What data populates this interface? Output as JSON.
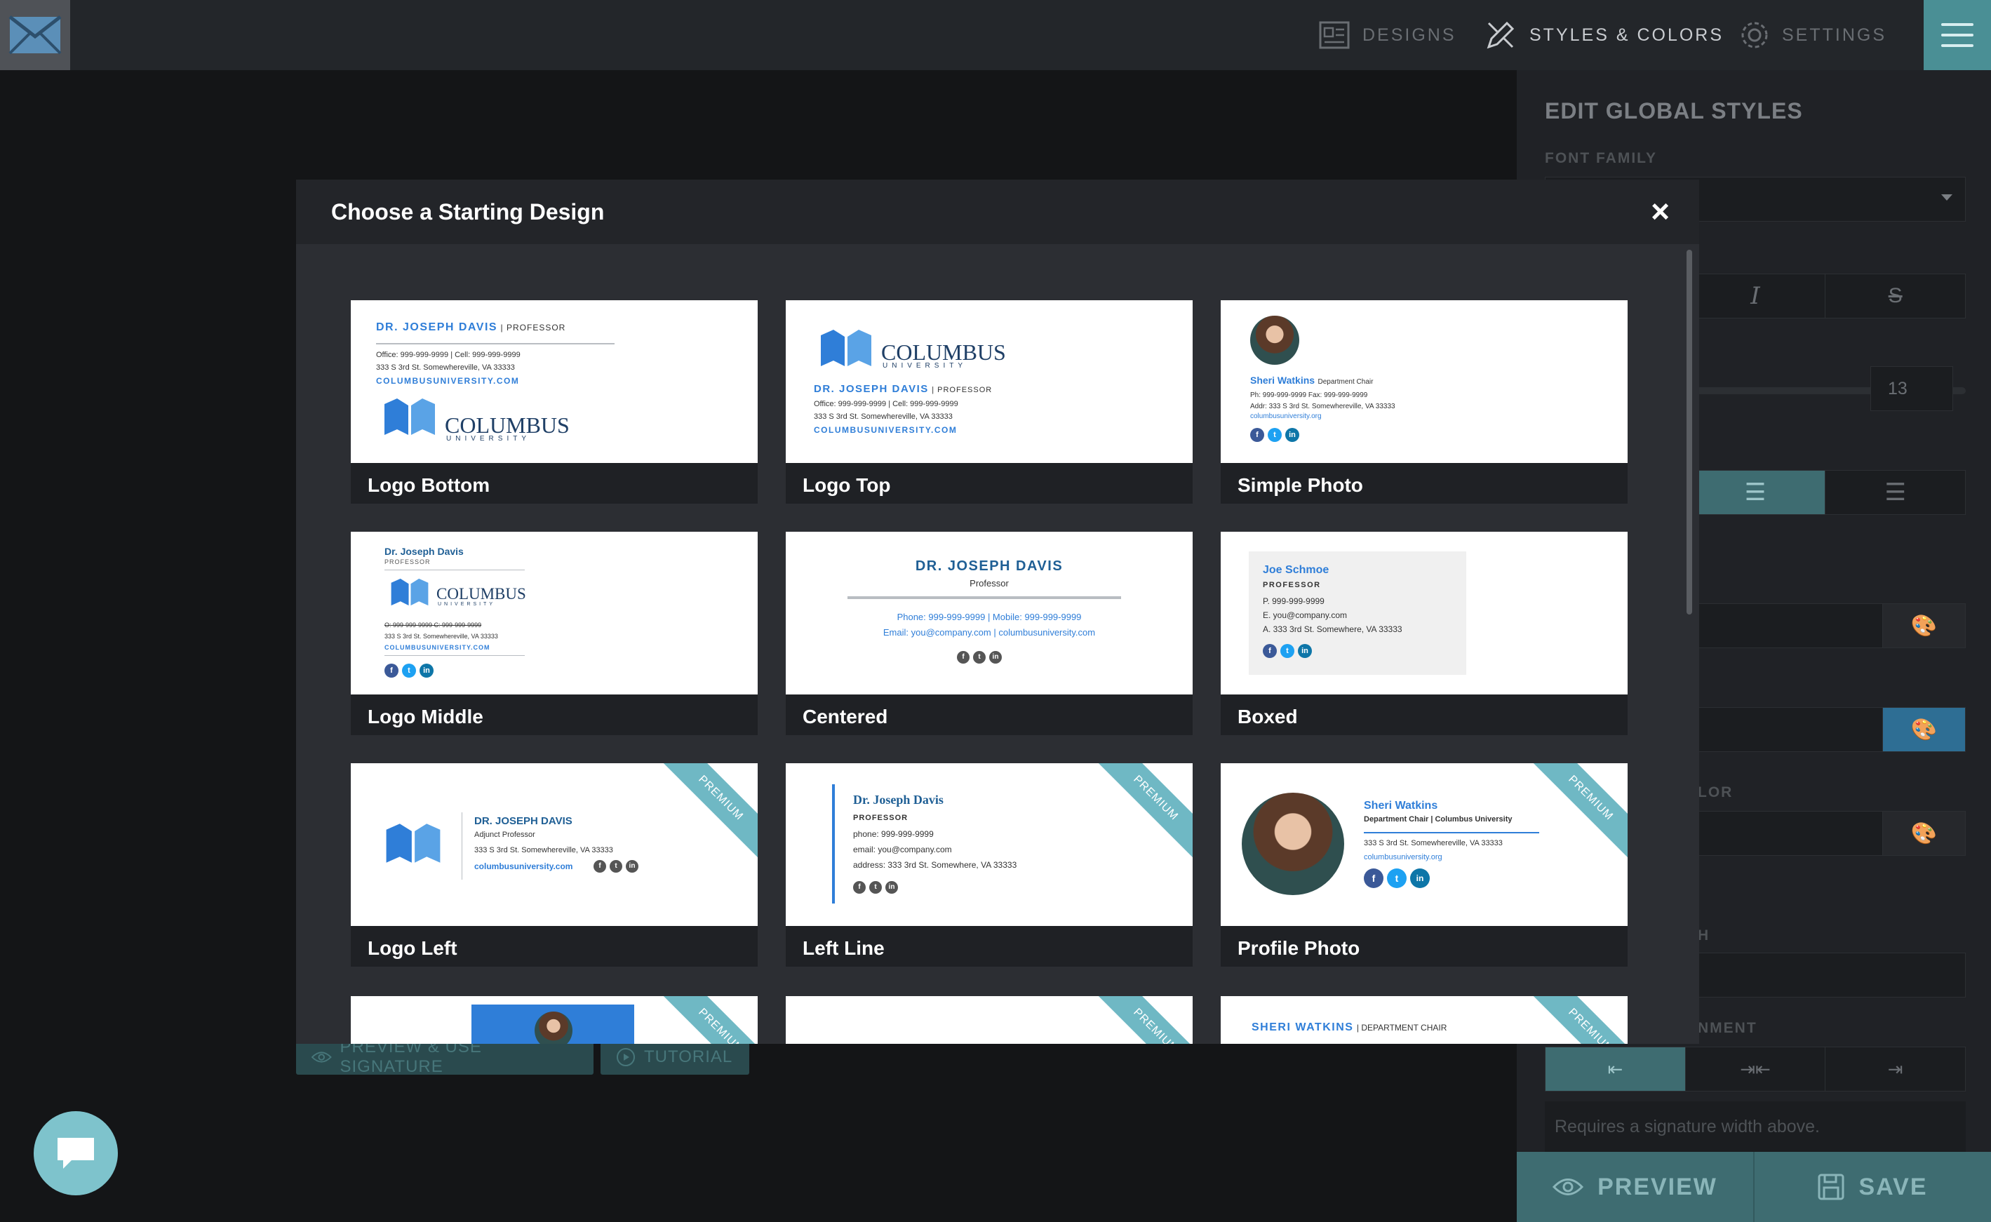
{
  "topbar": {
    "nav": [
      {
        "label": "DESIGNS"
      },
      {
        "label": "STYLES & COLORS"
      },
      {
        "label": "SETTINGS"
      }
    ]
  },
  "right_panel": {
    "title": "EDIT GLOBAL STYLES",
    "font_family_label": "FONT FAMILY",
    "font_size_value": "13",
    "color_label_fragment": "LOR",
    "width_label_fragment": "H",
    "alignment_label_fragment": "NMENT",
    "requires_note": "Requires a signature width above.",
    "preview_label": "PREVIEW",
    "save_label": "SAVE"
  },
  "background_buttons": {
    "preview_use": "PREVIEW & USE SIGNATURE",
    "tutorial": "TUTORIAL"
  },
  "modal": {
    "title": "Choose a Starting Design",
    "close": "×",
    "premium_label": "PREMIUM",
    "designs": [
      {
        "label": "Logo Bottom"
      },
      {
        "label": "Logo Top"
      },
      {
        "label": "Simple Photo"
      },
      {
        "label": "Logo Middle"
      },
      {
        "label": "Centered"
      },
      {
        "label": "Boxed"
      },
      {
        "label": "Logo Left"
      },
      {
        "label": "Left Line"
      },
      {
        "label": "Profile Photo"
      }
    ]
  },
  "signature_samples": {
    "name_caps": "DR. JOSEPH DAVIS",
    "title_sep": "| PROFESSOR",
    "office_line": "Office: 999-999-9999 | Cell: 999-999-9999",
    "address": "333 S 3rd St. Somewhereville, VA 33333",
    "url_caps": "COLUMBUSUNIVERSITY.COM",
    "columbus": "COLUMBUS",
    "university": "UNIVERSITY",
    "professor_caps": "PROFESSOR",
    "sheri_name": "Sheri Watkins",
    "sheri_title": "Department Chair",
    "ph_line": "Ph: 999-999-9999   Fax: 999-999-9999",
    "addr_line": "Addr: 333 S 3rd St. Somewhereville, VA 33333",
    "columbus_org": "columbusuniversity.org",
    "dr_mixed": "Dr. Joseph Davis",
    "professor_small": "PROFESSOR",
    "strike_line": "O: 999-999-9999   C: 999-999-9999",
    "professor_mixed": "Professor",
    "phone_mobile": "Phone: 999-999-9999 | Mobile: 999-999-9999",
    "email_line": "Email: you@company.com | columbusuniversity.com",
    "joe_name": "Joe Schmoe",
    "boxed_p": "P. 999-999-9999",
    "boxed_e": "E. you@company.com",
    "boxed_a": "A. 333 3rd St. Somewhere, VA 33333",
    "adjunct": "Adjunct Professor",
    "columbus_com": "columbusuniversity.com",
    "leftline_name": "Dr. Joseph Davis",
    "phone_l": "phone: 999-999-9999",
    "email_l": "email: you@company.com",
    "address_l": "address: 333 3rd St. Somewhere, VA 33333",
    "dept_chair_line": "Department Chair | Columbus University",
    "sheri_caps": "SHERI WATKINS",
    "dept_chair_caps": "| DEPARTMENT CHAIR"
  }
}
